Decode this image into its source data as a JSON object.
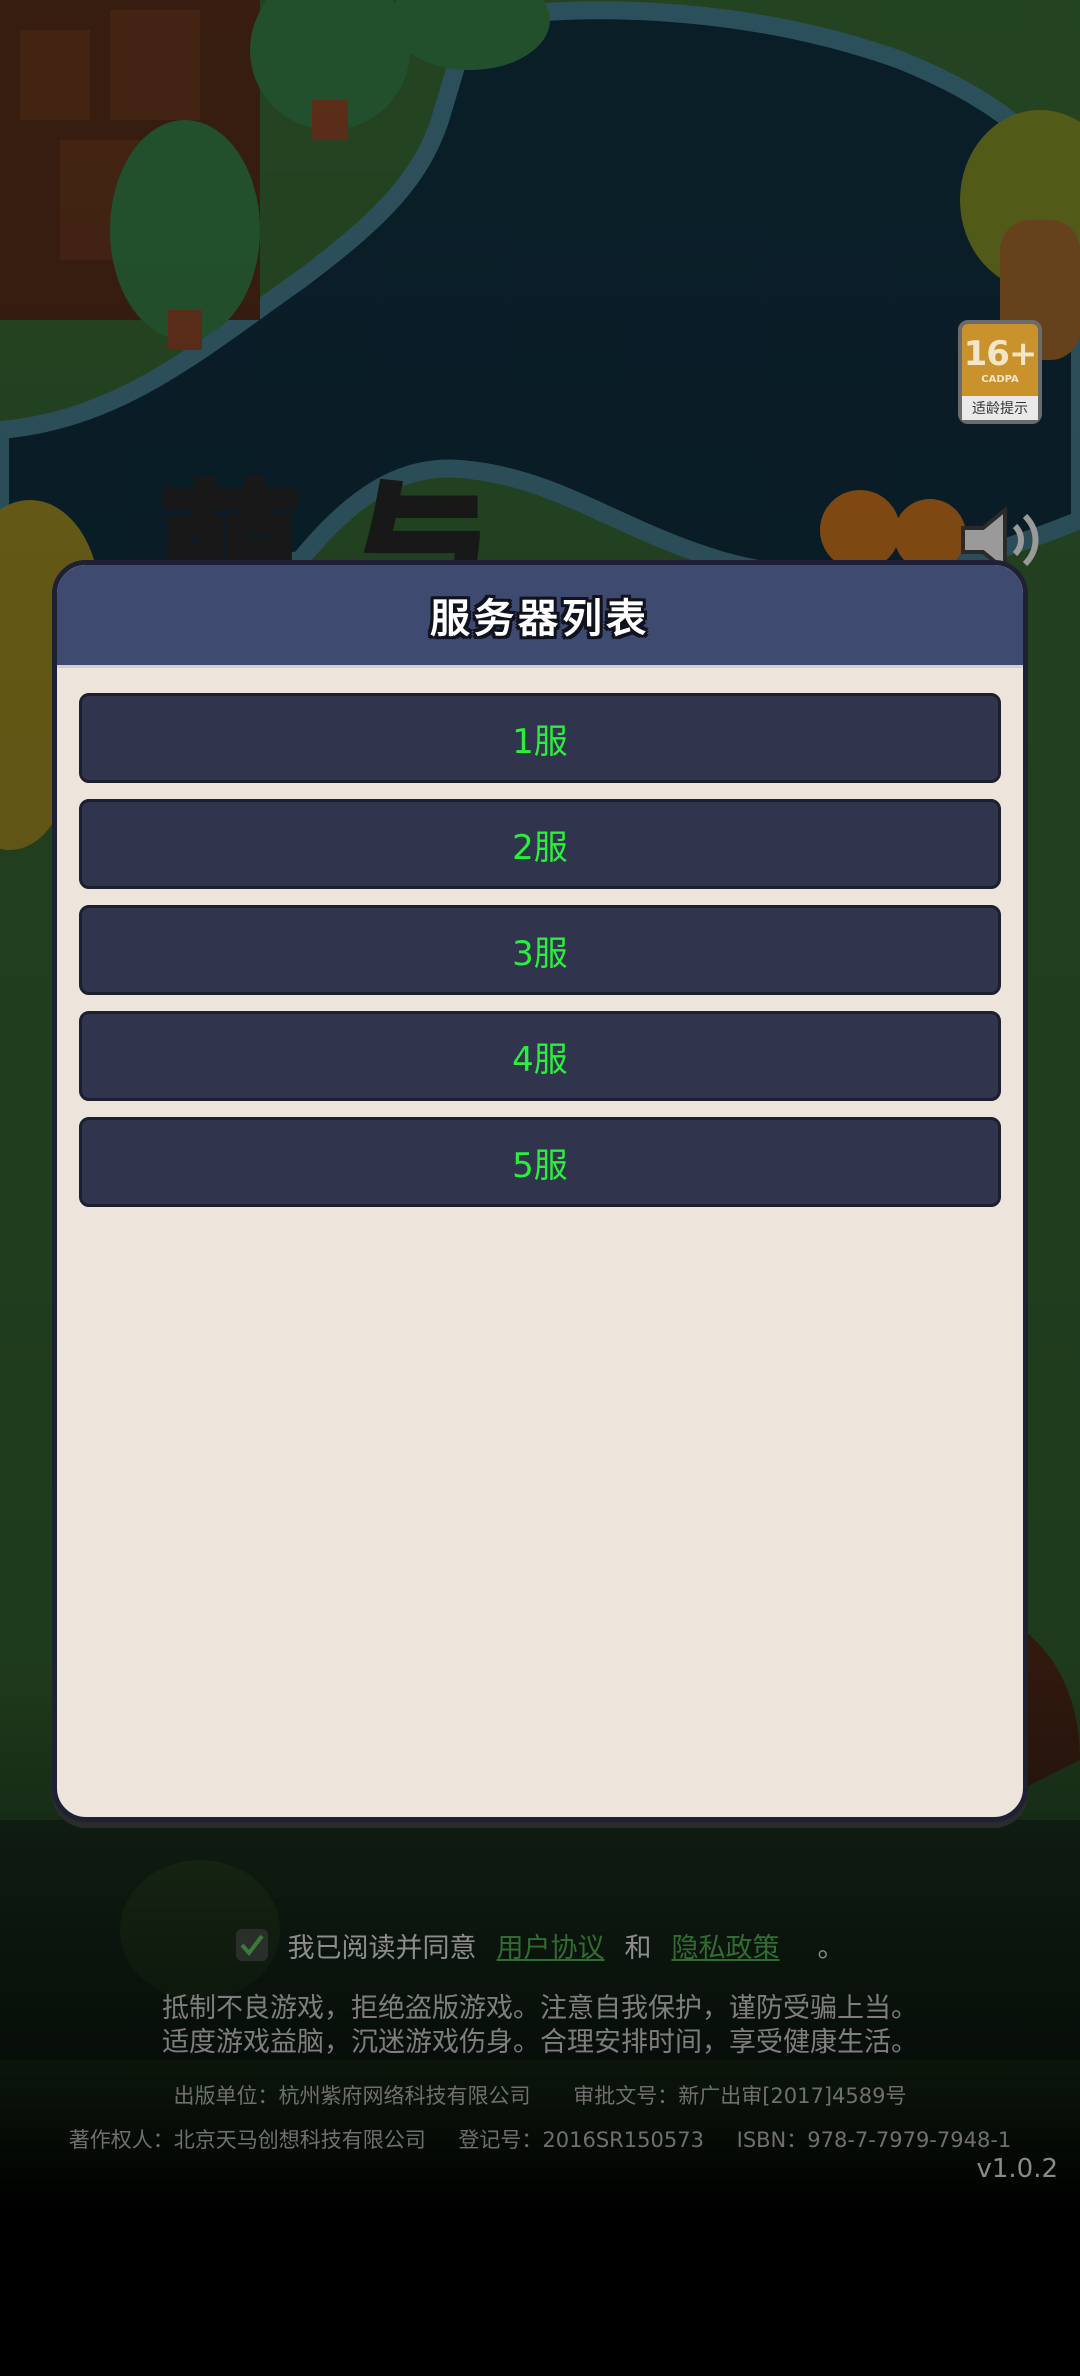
{
  "age_badge": {
    "age": "16+",
    "rating_org": "CADPA",
    "label": "适龄提示"
  },
  "dialog": {
    "title": "服务器列表",
    "servers": [
      {
        "label": "1服"
      },
      {
        "label": "2服"
      },
      {
        "label": "3服"
      },
      {
        "label": "4服"
      },
      {
        "label": "5服"
      }
    ]
  },
  "agreement": {
    "checked": true,
    "prefix": "我已阅读并同意",
    "user_agreement": "用户协议",
    "and": "和",
    "privacy_policy": "隐私政策",
    "suffix": "。"
  },
  "legal": {
    "line1": "抵制不良游戏，拒绝盗版游戏。注意自我保护，谨防受骗上当。",
    "line2": "适度游戏益脑，沉迷游戏伤身。合理安排时间，享受健康生活。",
    "publisher": "出版单位：杭州紫府网络科技有限公司",
    "approval": "审批文号：新广出审[2017]4589号",
    "copyright": "著作权人：北京天马创想科技有限公司",
    "registration": "登记号：2016SR150573",
    "isbn": "ISBN：978-7-7979-7948-1"
  },
  "version": "v1.0.2",
  "colors": {
    "dialog_bg": "#ede4dc",
    "header_bg": "#3e4a70",
    "server_btn_bg": "#30344c",
    "server_text": "#2af03c",
    "link": "#2f6d31"
  }
}
